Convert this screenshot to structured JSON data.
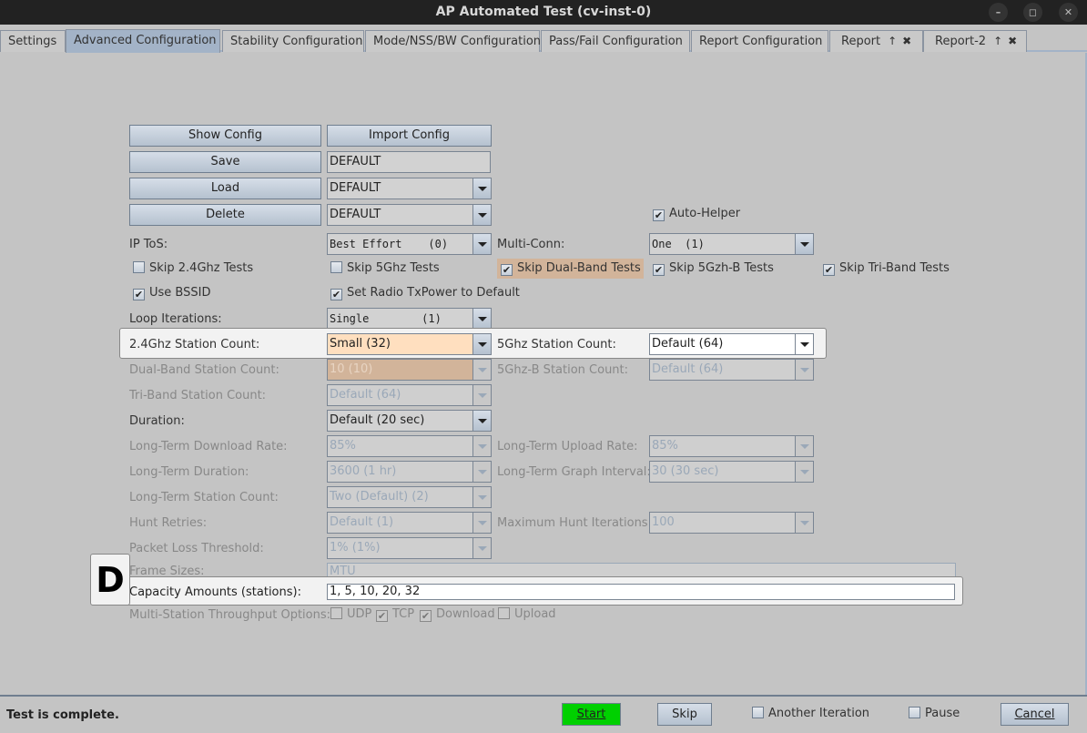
{
  "window": {
    "title": "AP Automated Test  (cv-inst-0)",
    "minimize_icon": "minimize-icon",
    "maximize_icon": "maximize-icon",
    "close_icon": "close-icon"
  },
  "tabs": [
    {
      "label": "Settings",
      "active": false
    },
    {
      "label": "Advanced Configuration",
      "active": true
    },
    {
      "label": "Stability Configuration",
      "active": false
    },
    {
      "label": "Mode/NSS/BW Configuration",
      "active": false
    },
    {
      "label": "Pass/Fail Configuration",
      "active": false
    },
    {
      "label": "Report Configuration",
      "active": false
    },
    {
      "label": "Report",
      "active": false,
      "undock": "↑",
      "close": "✖"
    },
    {
      "label": "Report-2",
      "active": false,
      "undock": "↑",
      "close": "✖"
    }
  ],
  "config": {
    "show_config": "Show Config",
    "import_config": "Import Config",
    "save": "Save",
    "save_name": "DEFAULT",
    "load": "Load",
    "load_value": "DEFAULT",
    "delete": "Delete",
    "delete_value": "DEFAULT",
    "auto_helper": {
      "label": "Auto-Helper",
      "checked": true
    }
  },
  "form": {
    "ip_tos": {
      "label": "IP ToS:",
      "value": "Best Effort    (0)"
    },
    "multi_conn": {
      "label": "Multi-Conn:",
      "value": "One  (1)"
    },
    "checkboxes_row1": [
      {
        "label": "Skip 2.4Ghz Tests",
        "checked": false
      },
      {
        "label": "Skip 5Ghz Tests",
        "checked": false
      },
      {
        "label": "Skip Dual-Band Tests",
        "checked": true,
        "highlighted": true
      },
      {
        "label": "Skip 5Gzh-B Tests",
        "checked": true
      },
      {
        "label": "Skip Tri-Band Tests",
        "checked": true
      }
    ],
    "checkboxes_row2": [
      {
        "label": "Use BSSID",
        "checked": true
      },
      {
        "label": "Set Radio TxPower to Default",
        "checked": true
      }
    ],
    "loop_iterations": {
      "label": "Loop Iterations:",
      "value": "Single        (1)"
    },
    "station_24": {
      "label": "2.4Ghz Station Count:",
      "value": "Small (32)"
    },
    "station_5": {
      "label": "5Ghz Station Count:",
      "value": "Default (64)"
    },
    "dual_band": {
      "label": "Dual-Band Station Count:",
      "value": "10 (10)"
    },
    "station_5b": {
      "label": "5Ghz-B Station Count:",
      "value": "Default (64)"
    },
    "tri_band": {
      "label": "Tri-Band Station Count:",
      "value": "Default (64)"
    },
    "duration": {
      "label": "Duration:",
      "value": "Default (20 sec)"
    },
    "lt_download": {
      "label": "Long-Term Download Rate:",
      "value": "85%"
    },
    "lt_upload": {
      "label": "Long-Term Upload Rate:",
      "value": "85%"
    },
    "lt_duration": {
      "label": "Long-Term Duration:",
      "value": "3600 (1 hr)"
    },
    "lt_graph": {
      "label": "Long-Term Graph Interval:",
      "value": "30 (30 sec)"
    },
    "lt_station": {
      "label": "Long-Term Station Count:",
      "value": "Two (Default) (2)"
    },
    "hunt_retries": {
      "label": "Hunt Retries:",
      "value": "Default (1)"
    },
    "max_hunt": {
      "label": "Maximum Hunt Iterations:",
      "value": "100"
    },
    "packet_loss": {
      "label": "Packet Loss Threshold:",
      "value": "1% (1%)"
    },
    "frame_sizes": {
      "label": "Frame Sizes:",
      "value": "MTU"
    },
    "capacity": {
      "label": "Capacity Amounts (stations):",
      "value": "1, 5, 10, 20, 32"
    },
    "multi_station": {
      "label": "Multi-Station Throughput Options:",
      "options": [
        {
          "label": "UDP",
          "checked": false
        },
        {
          "label": "TCP",
          "checked": true
        },
        {
          "label": "Download",
          "checked": true
        },
        {
          "label": "Upload",
          "checked": false
        }
      ]
    }
  },
  "annotation": {
    "badge": "D"
  },
  "status": {
    "message": "Test is complete.",
    "start": "Start",
    "skip": "Skip",
    "another_iteration": {
      "label": "Another Iteration",
      "checked": false
    },
    "pause": {
      "label": "Pause",
      "checked": false
    },
    "cancel": "Cancel"
  }
}
